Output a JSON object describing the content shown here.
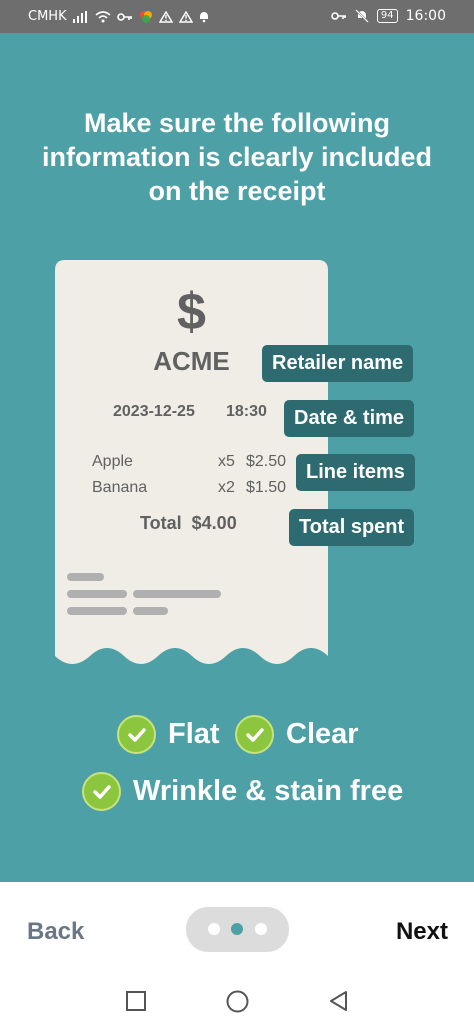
{
  "status_bar": {
    "carrier": "CMHK",
    "battery": "94",
    "time": "16:00"
  },
  "headline": "Make sure the following information is clearly included on the receipt",
  "receipt": {
    "symbol": "$",
    "store_name": "ACME",
    "date": "2023-12-25",
    "time": "18:30",
    "items": [
      {
        "name": "Apple",
        "qty": "x5",
        "price": "$2.50"
      },
      {
        "name": "Banana",
        "qty": "x2",
        "price": "$1.50"
      }
    ],
    "total": "Total  $4.00"
  },
  "tags": {
    "retailer": "Retailer name",
    "datetime": "Date & time",
    "line_items": "Line items",
    "total_spent": "Total spent"
  },
  "checks": {
    "flat": "Flat",
    "clear": "Clear",
    "wrinkle": "Wrinkle & stain free"
  },
  "footer": {
    "back": "Back",
    "next": "Next",
    "pager_total": 3,
    "pager_active": 2
  },
  "colors": {
    "teal_background": "#4da0a6",
    "tag_background": "#2e6b70",
    "receipt_paper": "#efede6",
    "check_green": "#8cc63e"
  }
}
